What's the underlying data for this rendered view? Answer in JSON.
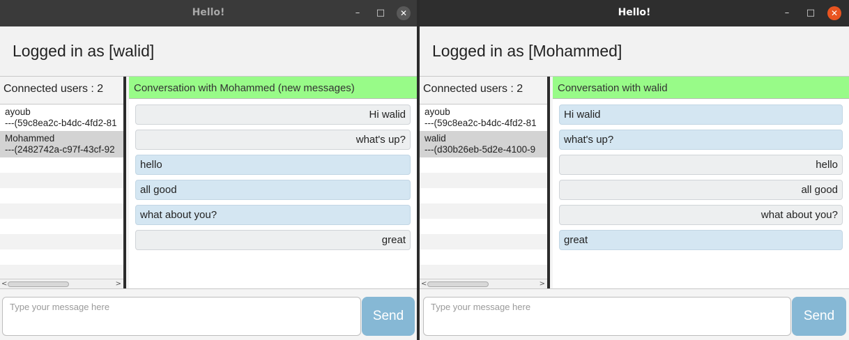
{
  "windows": [
    {
      "title": "Hello!",
      "logged_in_text": "Logged in as [walid]",
      "connected_users_text": "Connected users : 2",
      "users": [
        {
          "name": "ayoub",
          "id": "---(59c8ea2c-b4dc-4fd2-81"
        },
        {
          "name": "Mohammed",
          "id": "---(2482742a-c97f-43cf-92"
        }
      ],
      "conversation_title": "Conversation with Mohammed (new messages)",
      "messages": [
        "Hi walid",
        "what's up?",
        "hello",
        "all good",
        "what about you?",
        "great"
      ],
      "input_placeholder": "Type your message here",
      "send_label": "Send"
    },
    {
      "title": "Hello!",
      "logged_in_text": "Logged in as [Mohammed]",
      "connected_users_text": "Connected users : 2",
      "users": [
        {
          "name": "ayoub",
          "id": "---(59c8ea2c-b4dc-4fd2-81"
        },
        {
          "name": "walid",
          "id": "---(d30b26eb-5d2e-4100-9"
        }
      ],
      "conversation_title": "Conversation with walid",
      "messages": [
        "Hi walid",
        "what's up?",
        "hello",
        "all good",
        "what about you?",
        "great"
      ],
      "input_placeholder": "Type your message here",
      "send_label": "Send"
    }
  ],
  "window_controls": {
    "minimize": "–",
    "maximize": "□",
    "close": "✕"
  },
  "scroll_arrows": {
    "left": "<",
    "right": ">"
  },
  "colors": {
    "conversation_header": "#98fb88",
    "incoming_bubble": "#edeff0",
    "outgoing_bubble": "#d4e6f2",
    "send_button": "#86b8d5",
    "close_active": "#e95420"
  }
}
